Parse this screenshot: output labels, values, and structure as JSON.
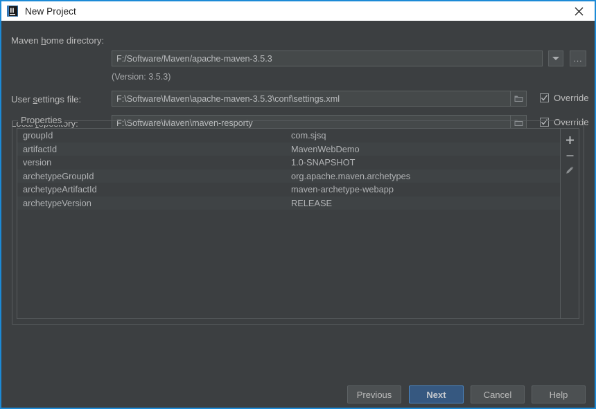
{
  "window": {
    "title": "New Project",
    "app_icon": "intellij-idea-icon",
    "close_icon": "close-icon",
    "border_color": "#1c8ad6",
    "background": "#3c3f41"
  },
  "form": {
    "maven_home": {
      "label_prefix": "Maven ",
      "label_mnemonic": "h",
      "label_suffix": "ome directory:",
      "value": "F:/Software/Maven/apache-maven-3.5.3",
      "dropdown_icon": "chevron-down-icon",
      "browse_label": "..."
    },
    "version_note": "(Version: 3.5.3)",
    "user_settings": {
      "label_prefix": "User ",
      "label_mnemonic": "s",
      "label_suffix": "ettings file:",
      "value": "F:\\Software\\Maven\\apache-maven-3.5.3\\conf\\settings.xml",
      "browse_icon": "folder-icon",
      "override_label": "Override",
      "override_checked": true
    },
    "local_repository": {
      "label_prefix": "Local ",
      "label_mnemonic": "r",
      "label_suffix": "epository:",
      "value": "F:\\Software\\Maven\\maven-resporty",
      "browse_icon": "folder-icon",
      "override_label": "Override",
      "override_checked": true
    }
  },
  "properties": {
    "legend": "Properties",
    "rows": [
      {
        "key": "groupId",
        "value": "com.sjsq"
      },
      {
        "key": "artifactId",
        "value": "MavenWebDemo"
      },
      {
        "key": "version",
        "value": "1.0-SNAPSHOT"
      },
      {
        "key": "archetypeGroupId",
        "value": "org.apache.maven.archetypes"
      },
      {
        "key": "archetypeArtifactId",
        "value": "maven-archetype-webapp"
      },
      {
        "key": "archetypeVersion",
        "value": "RELEASE"
      }
    ],
    "toolbar": {
      "add_icon": "plus-icon",
      "remove_icon": "minus-icon",
      "edit_icon": "pencil-icon"
    }
  },
  "footer": {
    "previous": "Previous",
    "next": "Next",
    "cancel": "Cancel",
    "help": "Help",
    "default_button": "Next",
    "default_button_color": "#365880"
  }
}
